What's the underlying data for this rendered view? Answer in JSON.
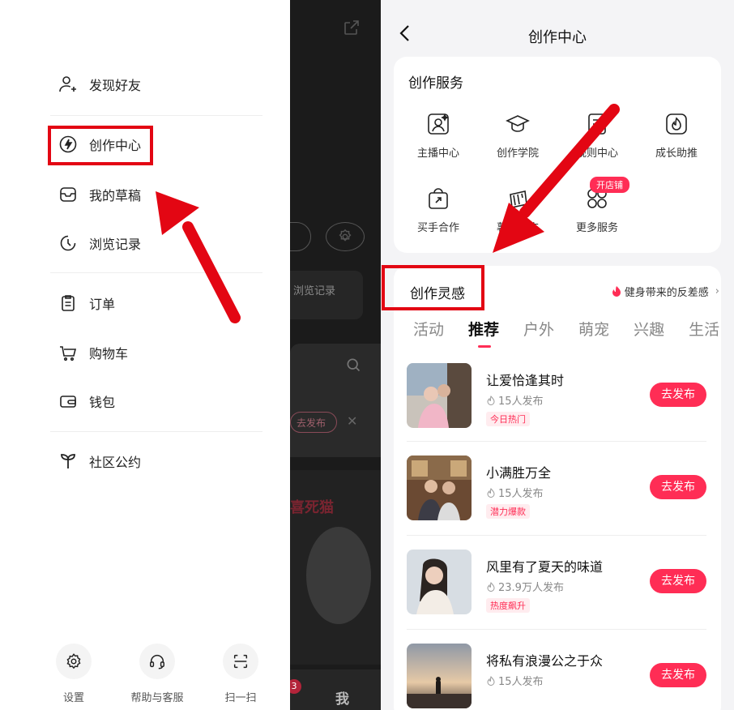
{
  "left_menu": {
    "items": [
      {
        "label": "发现好友",
        "icon": "add-friend-icon"
      },
      {
        "label": "创作中心",
        "icon": "lightning-icon"
      },
      {
        "label": "我的草稿",
        "icon": "inbox-icon"
      },
      {
        "label": "浏览记录",
        "icon": "clock-icon"
      },
      {
        "label": "订单",
        "icon": "clipboard-icon"
      },
      {
        "label": "购物车",
        "icon": "cart-icon"
      },
      {
        "label": "钱包",
        "icon": "wallet-icon"
      },
      {
        "label": "社区公约",
        "icon": "sprout-icon"
      }
    ],
    "bottom": [
      {
        "label": "设置",
        "icon": "gear-icon"
      },
      {
        "label": "帮助与客服",
        "icon": "headset-icon"
      },
      {
        "label": "扫一扫",
        "icon": "scan-icon"
      }
    ]
  },
  "middle": {
    "browse_label": "浏览记录",
    "tag_label": "去发布",
    "cat_text": "喜死猫",
    "me_label": "我",
    "small_badge": "3"
  },
  "creation_center": {
    "title": "创作中心",
    "services": {
      "title": "创作服务",
      "items": [
        {
          "label": "主播中心",
          "icon": "streamer-icon"
        },
        {
          "label": "创作学院",
          "icon": "graduation-cap-icon"
        },
        {
          "label": "规则中心",
          "icon": "rules-icon"
        },
        {
          "label": "成长助推",
          "icon": "flame-icon"
        },
        {
          "label": "买手合作",
          "icon": "shopping-bag-icon"
        },
        {
          "label": "薯条推广",
          "icon": "fries-icon"
        },
        {
          "label": "更多服务",
          "icon": "apps-icon"
        }
      ],
      "shop_badge": "开店铺"
    },
    "inspiration": {
      "title": "创作灵感",
      "hot_topic": "健身带来的反差感",
      "tabs": [
        "活动",
        "推荐",
        "户外",
        "萌宠",
        "兴趣",
        "生活"
      ],
      "active_tab": 1,
      "publish_label": "去发布",
      "items": [
        {
          "title": "让爱恰逢其时",
          "count": "15人发布",
          "tag": "今日热门"
        },
        {
          "title": "小满胜万全",
          "count": "15人发布",
          "tag": "潜力爆款"
        },
        {
          "title": "风里有了夏天的味道",
          "count": "23.9万人发布",
          "tag": "热度飙升"
        },
        {
          "title": "将私有浪漫公之于众",
          "count": "15人发布",
          "tag": ""
        }
      ]
    }
  },
  "colors": {
    "accent": "#ff2d55",
    "annotation": "#e30613",
    "dark_panel": "#1b1b1b"
  }
}
